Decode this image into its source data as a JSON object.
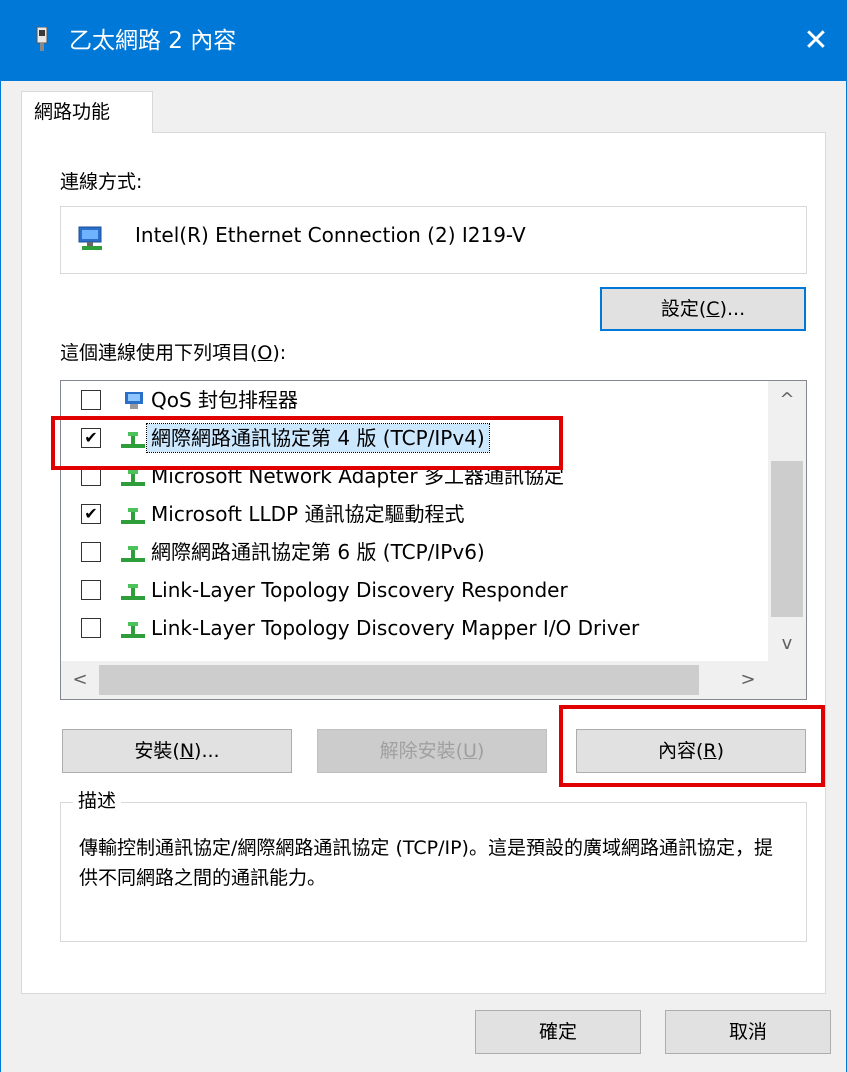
{
  "window": {
    "title": "乙太網路 2 內容",
    "close_label": "✕"
  },
  "tab": {
    "label": "網路功能"
  },
  "connect": {
    "label": "連線方式:",
    "adapter_name": "Intel(R) Ethernet Connection (2) I219-V",
    "configure_label_pre": "設定(",
    "configure_label_key": "C",
    "configure_label_post": ")..."
  },
  "items_section": {
    "label_pre": "這個連線使用下列項目(",
    "label_key": "O",
    "label_post": "):"
  },
  "items": [
    {
      "label": "QoS 封包排程器",
      "checked": false,
      "icon": "scheduler-icon"
    },
    {
      "label": "網際網路通訊協定第 4 版 (TCP/IPv4)",
      "checked": true,
      "selected": true,
      "icon": "protocol-icon"
    },
    {
      "label": "Microsoft Network Adapter 多工器通訊協定",
      "checked": false,
      "icon": "protocol-icon"
    },
    {
      "label": "Microsoft LLDP 通訊協定驅動程式",
      "checked": true,
      "icon": "protocol-icon"
    },
    {
      "label": "網際網路通訊協定第 6 版 (TCP/IPv6)",
      "checked": false,
      "icon": "protocol-icon"
    },
    {
      "label": "Link-Layer Topology Discovery Responder",
      "checked": false,
      "icon": "protocol-icon"
    },
    {
      "label": "Link-Layer Topology Discovery Mapper I/O Driver",
      "checked": false,
      "icon": "protocol-icon"
    }
  ],
  "check_glyph": "✔",
  "scroll": {
    "up": "^",
    "down": "v",
    "left": "<",
    "right": ">"
  },
  "buttons": {
    "install_pre": "安裝(",
    "install_key": "N",
    "install_post": ")...",
    "uninstall_pre": "解除安裝(",
    "uninstall_key": "U",
    "uninstall_post": ")",
    "properties_pre": "內容(",
    "properties_key": "R",
    "properties_post": ")"
  },
  "description": {
    "title": "描述",
    "text": "傳輸控制通訊協定/網際網路通訊協定 (TCP/IP)。這是預設的廣域網路通訊協定，提供不同網路之間的通訊能力。"
  },
  "footer": {
    "ok_label": "確定",
    "cancel_label": "取消"
  },
  "colors": {
    "accent": "#0078d7",
    "highlight": "#e00000",
    "selection": "#cce8ff"
  }
}
